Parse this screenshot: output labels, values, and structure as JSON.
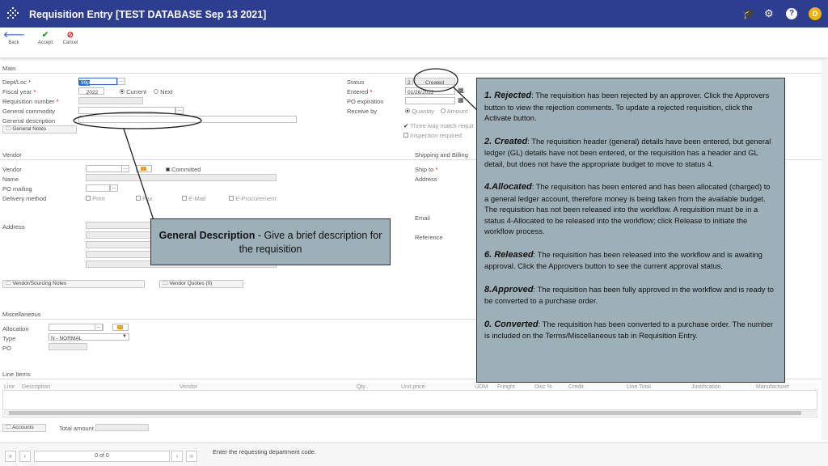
{
  "app": {
    "title": "Requisition Entry [TEST DATABASE Sep 13 2021]",
    "avatar_letter": "D",
    "header_color": "#2d3e8e"
  },
  "toolbar": {
    "back": "Back",
    "accept": "Accept",
    "cancel": "Cancel"
  },
  "main": {
    "section": "Main",
    "dept_loc_label": "Dept/Loc",
    "dept_loc_value": "99p",
    "fiscal_year_label": "Fiscal year",
    "fiscal_year_value": "2022",
    "current_label": "Current",
    "next_label": "Next",
    "req_number_label": "Requisition number",
    "commodity_label": "General commodity",
    "description_label": "General description",
    "general_notes": "General Notes",
    "status_label": "Status",
    "status_value": "Created",
    "status_code": "2",
    "entered_label": "Entered",
    "entered_value": "01/26/2022",
    "po_expiration_label": "PO expiration",
    "receive_by_label": "Receive by",
    "quantity_label": "Quantity",
    "amount_label": "Amount",
    "three_way_label": "Three way match requir",
    "inspection_label": "Inspection required"
  },
  "vendor": {
    "section": "Vendor",
    "vendor_label": "Vendor",
    "committed_label": "Committed",
    "name_label": "Name",
    "po_mailing_label": "PO mailing",
    "delivery_label": "Delivery method",
    "print": "Print",
    "fax": "Fax",
    "email": "E-Mail",
    "eprocurement": "E-Procurement",
    "address_label": "Address",
    "sourcing_notes": "Vendor/Sourcing Notes",
    "vendor_quotes": "Vendor Quotes (0)"
  },
  "shipping": {
    "section": "Shipping and Billing",
    "ship_to_label": "Ship to",
    "address_label": "Address",
    "email_label": "Email",
    "reference_label": "Reference"
  },
  "misc": {
    "section": "Miscellaneous",
    "allocation_label": "Allocation",
    "type_label": "Type",
    "type_value": "N - NORMAL",
    "po_label": "PO"
  },
  "line_items": {
    "section": "Line Items",
    "columns": [
      "Line",
      "Description",
      "Vendor",
      "Qty",
      "Unit price",
      "UOM",
      "Freight",
      "Disc %",
      "Credit",
      "Line Total",
      "Justification",
      "Manufacturer"
    ]
  },
  "accounts": {
    "button": "Accounts",
    "total_label": "Total amount"
  },
  "footer": {
    "page_text": "0 of 0",
    "hint": "Enter the requesting department code."
  },
  "callouts": {
    "general_description_title": "General Description",
    "general_description_text": " - Give a brief description for the requisition",
    "status_items": [
      {
        "title": "1. Rejected",
        "text": ": The requisition has been rejected by an approver. Click the Approvers button to view the rejection comments. To update a rejected requisition, click the Activate button."
      },
      {
        "title": "2. Created",
        "text": ": The requisition header (general) details have been entered, but general ledger (GL) details have not been entered, or the requisition has a header and GL detail, but does not have the appropriate budget to move to status 4."
      },
      {
        "title": "4.Allocated",
        "text": ": The requisition has been entered and has been allocated (charged) to a general ledger account, therefore money is being taken from the available budget. The requisition has not been released into the workflow. A requisition must be in a status 4-Allocated to be released into the workflow; click Release to initiate the workflow process."
      },
      {
        "title": "6. Released",
        "text": ": The requisition has been released into the workflow and is awaiting approval. Click the Approvers button to see the current approval status."
      },
      {
        "title": "8.Approved",
        "text": ": The requisition has been fully approved in the workflow and is ready to be converted to a purchase order."
      },
      {
        "title": "0. Converted",
        "text": ": The requisition has been converted to a purchase order. The number is included on the Terms/Miscellaneous tab in Requisition Entry."
      }
    ]
  }
}
